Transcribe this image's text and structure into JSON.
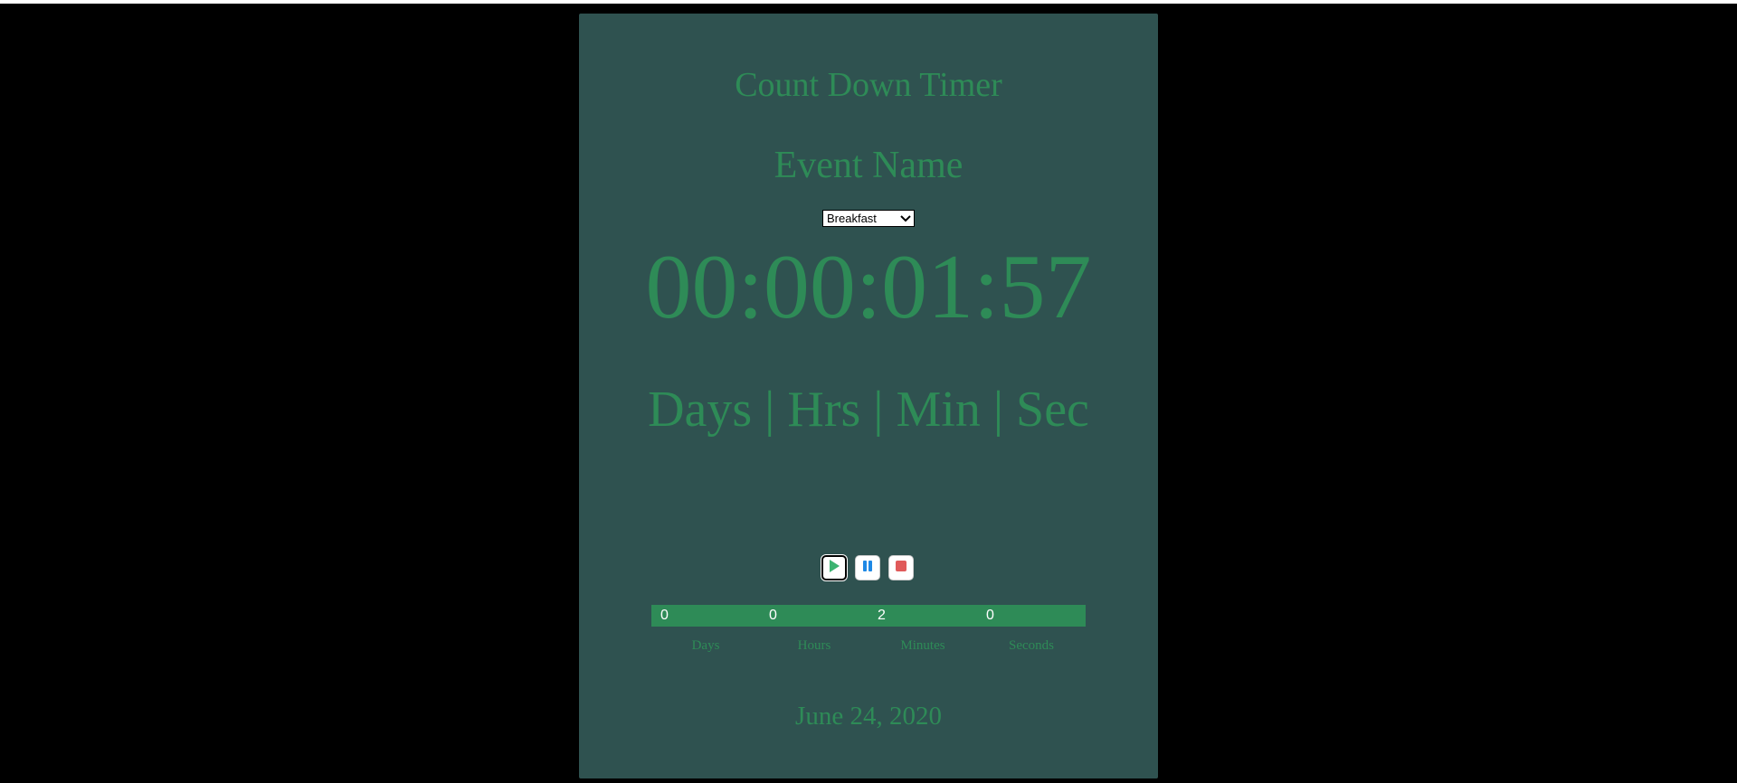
{
  "app": {
    "title": "Count Down Timer",
    "event_label": "Event Name"
  },
  "event_select": {
    "selected": "Breakfast"
  },
  "clock": {
    "display": "00:00:01:57",
    "units": "Days | Hrs | Min | Sec"
  },
  "controls": {
    "play_icon": "play-icon",
    "pause_icon": "pause-icon",
    "stop_icon": "stop-icon"
  },
  "breakdown": {
    "values": [
      "0",
      "0",
      "2",
      "0"
    ],
    "labels": [
      "Days",
      "Hours",
      "Minutes",
      "Seconds"
    ]
  },
  "footer": {
    "date": "June 24, 2020"
  },
  "colors": {
    "page_background": "#000000",
    "card_background": "#2f5250",
    "accent_green": "#2e8b57",
    "play_green": "#3cb371",
    "pause_blue": "#1e88e5",
    "stop_red": "#e05a5a"
  }
}
